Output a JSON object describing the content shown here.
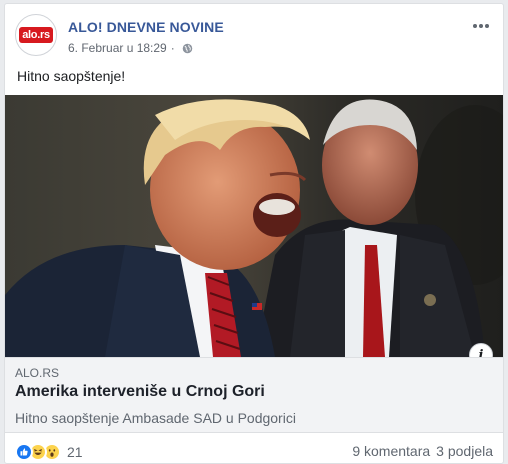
{
  "post": {
    "page_name": "ALO! DNEVNE NOVINE",
    "avatar_text": "alo.rs",
    "date": "6. Februar u 18:29",
    "separator": "·",
    "privacy_icon": "globe-icon",
    "text": "Hitno saopštenje!"
  },
  "link": {
    "domain": "ALO.RS",
    "title": "Amerika interveniše u Crnoj Gori",
    "description": "Hitno saopštenje Ambasade SAD u Podgorici",
    "info_label": "i"
  },
  "footer": {
    "reactions": [
      "like-icon",
      "haha-icon",
      "wow-icon"
    ],
    "reaction_count": "21",
    "comments": "9 komentara",
    "shares": "3 podjela"
  },
  "colors": {
    "page_name": "#385898",
    "brand_red": "#d7191f",
    "like_blue": "#1877f2",
    "emoji_yellow": "#fcd34d"
  }
}
